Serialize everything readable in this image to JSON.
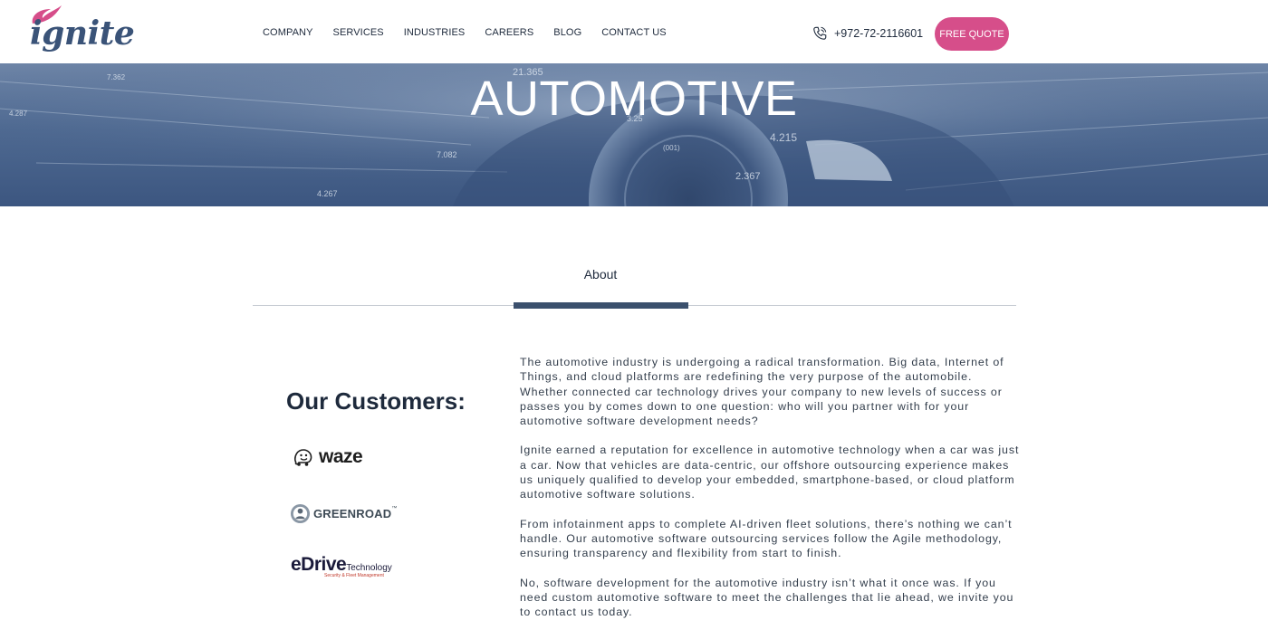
{
  "header": {
    "logo_text": "ignite",
    "nav": [
      "COMPANY",
      "SERVICES",
      "INDUSTRIES",
      "CAREERS",
      "BLOG",
      "CONTACT US"
    ],
    "phone": "+972-72-2116601",
    "cta": "FREE QUOTE"
  },
  "hero": {
    "title": "AUTOMOTIVE",
    "overlay_numbers": [
      "21.365",
      "7.362",
      "4.287",
      "4.215",
      "2.367",
      "7.082",
      "4.267",
      "(001)",
      "3.25"
    ]
  },
  "about": {
    "tab_label": "About"
  },
  "customers": {
    "title": "Our Customers:",
    "logos": [
      {
        "name": "waze",
        "icon": "waze-icon"
      },
      {
        "name": "GREENROAD",
        "trademark": "™",
        "icon": "greenroad-icon"
      },
      {
        "name": "eDrive",
        "suffix": "Technology",
        "tagline": "Security & Fleet Management"
      }
    ]
  },
  "content": {
    "paragraphs": [
      "The automotive industry is undergoing a radical transformation. Big data, Internet of Things, and cloud platforms are redefining the very purpose of the automobile. Whether connected car technology drives your company to new levels of success or passes you by comes down to one question: who will you partner with for your automotive software development needs?",
      "Ignite earned a reputation for excellence in automotive technology when a car was just a car. Now that vehicles are data-centric, our offshore outsourcing experience makes us uniquely qualified to develop your embedded, smartphone-based, or cloud platform automotive software solutions.",
      "From infotainment apps to complete AI-driven fleet solutions, there’s nothing we can’t handle. Our automotive software outsourcing services follow the Agile methodology, ensuring transparency and flexibility from start to finish.",
      "No, software development for the automotive industry isn’t what it once was. If you need custom automotive software to meet the challenges that lie ahead, we invite you to contact us today."
    ]
  },
  "colors": {
    "accent": "#d64e8a",
    "brand_blue": "#3b506d",
    "text": "#1e2a3c"
  }
}
